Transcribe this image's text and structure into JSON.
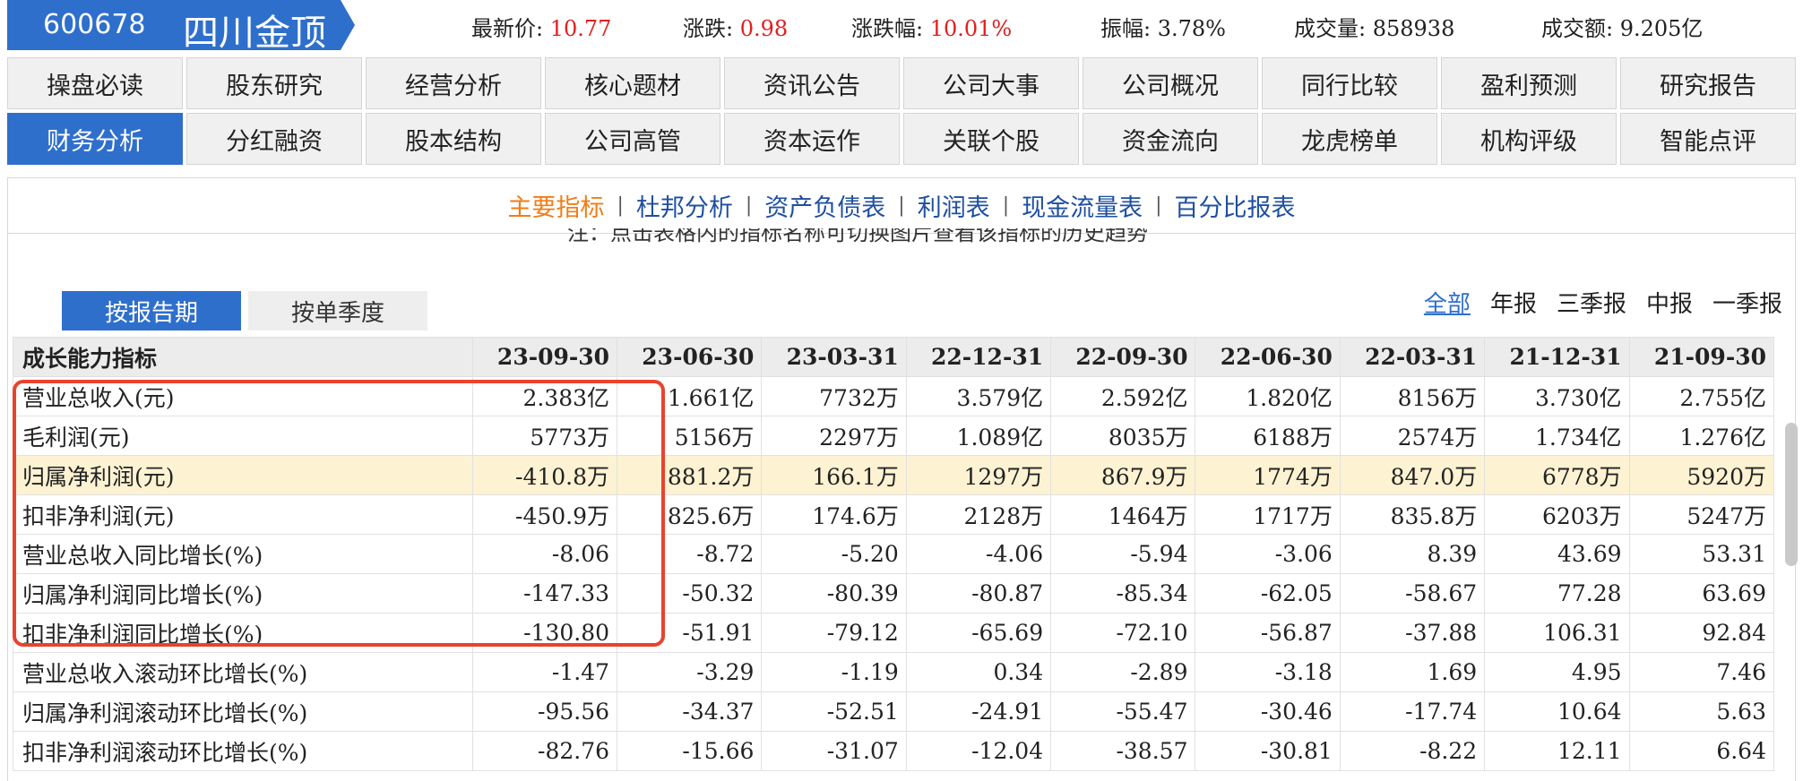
{
  "stock": {
    "code": "600678",
    "name": "四川金顶"
  },
  "quote": [
    {
      "label": "最新价: ",
      "value": "10.77",
      "red": true
    },
    {
      "label": "涨跌: ",
      "value": "0.98",
      "red": true
    },
    {
      "label": "涨跌幅: ",
      "value": "10.01%",
      "red": true
    },
    {
      "label": "振幅: ",
      "value": "3.78%",
      "red": false
    },
    {
      "label": "成交量: ",
      "value": "858938",
      "red": false
    },
    {
      "label": "成交额: ",
      "value": "9.205亿",
      "red": false
    }
  ],
  "nav": {
    "row1": [
      "操盘必读",
      "股东研究",
      "经营分析",
      "核心题材",
      "资讯公告",
      "公司大事",
      "公司概况",
      "同行比较",
      "盈利预测",
      "研究报告"
    ],
    "row2": [
      "财务分析",
      "分红融资",
      "股本结构",
      "公司高管",
      "资本运作",
      "关联个股",
      "资金流向",
      "龙虎榜单",
      "机构评级",
      "智能点评"
    ],
    "active": "财务分析"
  },
  "subnav": {
    "items": [
      "主要指标",
      "杜邦分析",
      "资产负债表",
      "利润表",
      "现金流量表",
      "百分比报表"
    ],
    "active": "主要指标"
  },
  "note": "注：点击表格内的指标名称可切换图片查看该指标的历史趋势",
  "period_tabs": {
    "items": [
      "按报告期",
      "按单季度"
    ],
    "active": "按报告期"
  },
  "filters": {
    "items": [
      "全部",
      "年报",
      "三季报",
      "中报",
      "一季报"
    ],
    "active": "全部"
  },
  "table": {
    "header": [
      "成长能力指标",
      "23-09-30",
      "23-06-30",
      "23-03-31",
      "22-12-31",
      "22-09-30",
      "22-06-30",
      "22-03-31",
      "21-12-31",
      "21-09-30"
    ],
    "rows": [
      {
        "label": "营业总收入(元)",
        "values": [
          "2.383亿",
          "1.661亿",
          "7732万",
          "3.579亿",
          "2.592亿",
          "1.820亿",
          "8156万",
          "3.730亿",
          "2.755亿"
        ]
      },
      {
        "label": "毛利润(元)",
        "values": [
          "5773万",
          "5156万",
          "2297万",
          "1.089亿",
          "8035万",
          "6188万",
          "2574万",
          "1.734亿",
          "1.276亿"
        ]
      },
      {
        "label": "归属净利润(元)",
        "values": [
          "-410.8万",
          "881.2万",
          "166.1万",
          "1297万",
          "867.9万",
          "1774万",
          "847.0万",
          "6778万",
          "5920万"
        ],
        "highlight": true
      },
      {
        "label": "扣非净利润(元)",
        "values": [
          "-450.9万",
          "825.6万",
          "174.6万",
          "2128万",
          "1464万",
          "1717万",
          "835.8万",
          "6203万",
          "5247万"
        ]
      },
      {
        "label": "营业总收入同比增长(%)",
        "values": [
          "-8.06",
          "-8.72",
          "-5.20",
          "-4.06",
          "-5.94",
          "-3.06",
          "8.39",
          "43.69",
          "53.31"
        ]
      },
      {
        "label": "归属净利润同比增长(%)",
        "values": [
          "-147.33",
          "-50.32",
          "-80.39",
          "-80.87",
          "-85.34",
          "-62.05",
          "-58.67",
          "77.28",
          "63.69"
        ]
      },
      {
        "label": "扣非净利润同比增长(%)",
        "values": [
          "-130.80",
          "-51.91",
          "-79.12",
          "-65.69",
          "-72.10",
          "-56.87",
          "-37.88",
          "106.31",
          "92.84"
        ]
      },
      {
        "label": "营业总收入滚动环比增长(%)",
        "values": [
          "-1.47",
          "-3.29",
          "-1.19",
          "0.34",
          "-2.89",
          "-3.18",
          "1.69",
          "4.95",
          "7.46"
        ]
      },
      {
        "label": "归属净利润滚动环比增长(%)",
        "values": [
          "-95.56",
          "-34.37",
          "-52.51",
          "-24.91",
          "-55.47",
          "-30.46",
          "-17.74",
          "10.64",
          "5.63"
        ]
      },
      {
        "label": "扣非净利润滚动环比增长(%)",
        "values": [
          "-82.76",
          "-15.66",
          "-31.07",
          "-12.04",
          "-38.57",
          "-30.81",
          "-8.22",
          "12.11",
          "6.64"
        ]
      }
    ]
  },
  "colors": {
    "accent": "#2f6fcc",
    "up": "#e0201f",
    "subnav_active": "#f07d18",
    "highlight_row": "#fdf3d3",
    "annotation": "#e8432f"
  }
}
